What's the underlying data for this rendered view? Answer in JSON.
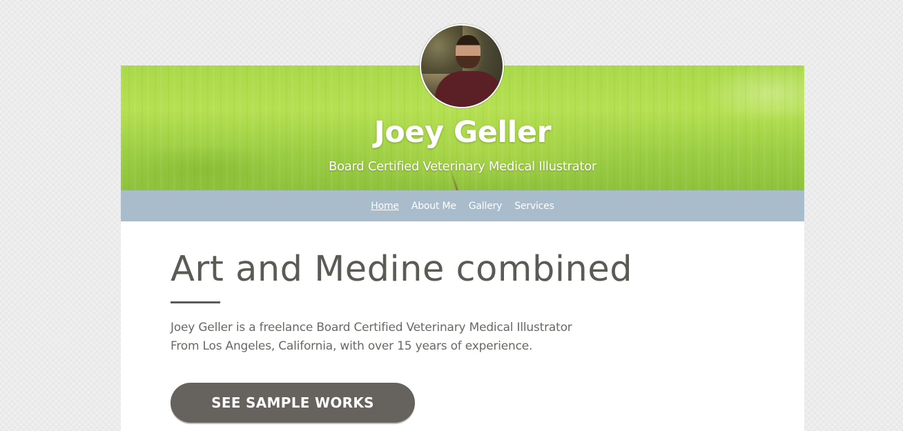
{
  "profile": {
    "name": "Joey Geller",
    "subtitle": "Board Certified Veterinary Medical Illustrator",
    "avatar_icon": "person-portrait"
  },
  "nav": {
    "items": [
      {
        "label": "Home",
        "active": true
      },
      {
        "label": "About Me",
        "active": false
      },
      {
        "label": "Gallery",
        "active": false
      },
      {
        "label": "Services",
        "active": false
      }
    ]
  },
  "main": {
    "headline": "Art and Medine combined",
    "intro_lines": [
      "Joey Geller is a freelance Board Certified Veterinary Medical Illustrator",
      "From Los Angeles, California, with over 15 years of experience."
    ],
    "cta_label": "SEE SAMPLE WORKS"
  },
  "colors": {
    "nav_bg": "#a8bccb",
    "hero_green": "#a9d94a",
    "button_bg": "#66625d",
    "heading_text": "#5c5a55"
  }
}
